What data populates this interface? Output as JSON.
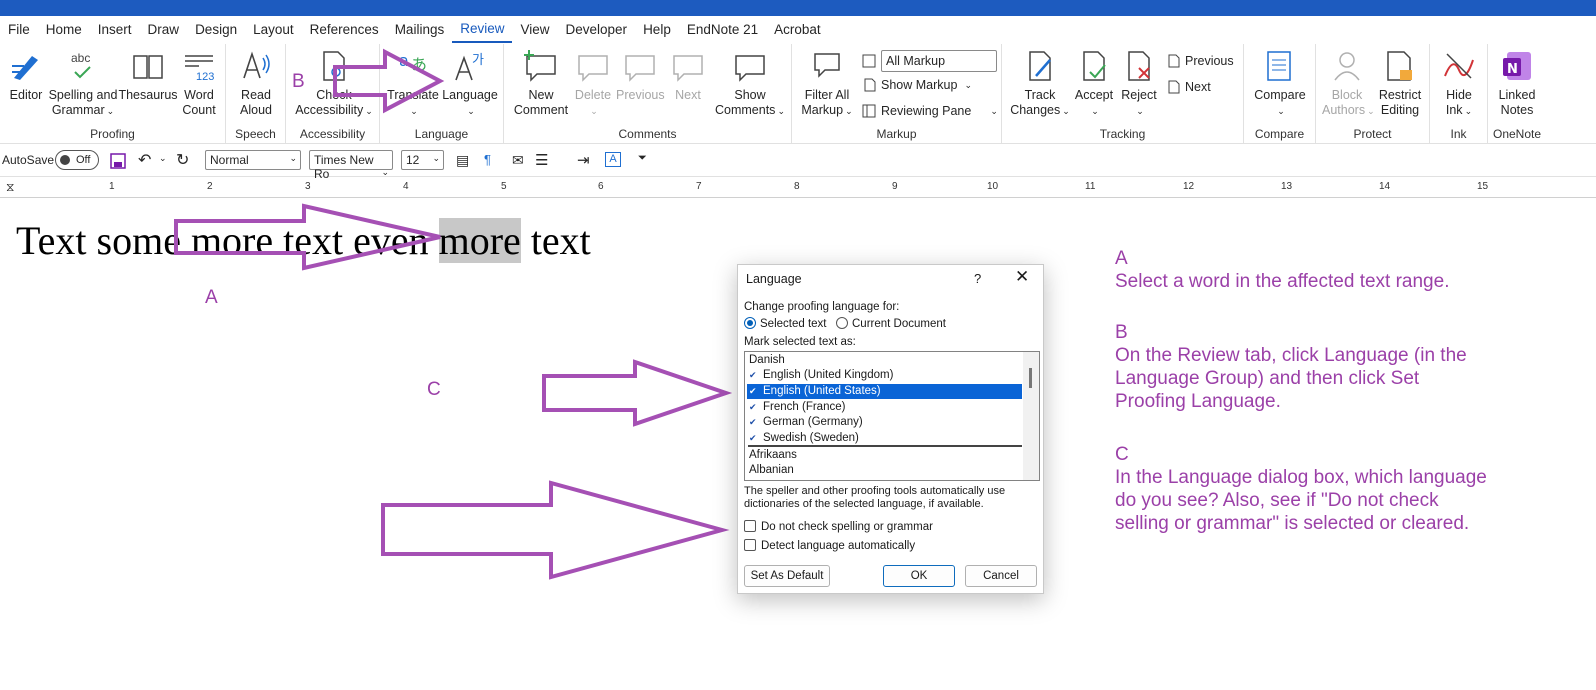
{
  "menu": [
    "File",
    "Home",
    "Insert",
    "Draw",
    "Design",
    "Layout",
    "References",
    "Mailings",
    "Review",
    "View",
    "Developer",
    "Help",
    "EndNote 21",
    "Acrobat"
  ],
  "active_menu": "Review",
  "ribbon": {
    "proofing": {
      "label": "Proofing",
      "editor": "Editor",
      "spelling_1": "Spelling and",
      "spelling_2": "Grammar",
      "thesaurus": "Thesaurus",
      "wordcount_1": "Word",
      "wordcount_2": "Count",
      "spelling_icon_text": "abc",
      "wordcount_icon_text": "123"
    },
    "speech": {
      "label": "Speech",
      "read_1": "Read",
      "read_2": "Aloud"
    },
    "accessibility": {
      "label": "Accessibility",
      "check_1": "Check",
      "check_2": "Accessibility"
    },
    "language": {
      "label": "Language",
      "translate": "Translate",
      "language": "Language"
    },
    "comments": {
      "label": "Comments",
      "new_1": "New",
      "new_2": "Comment",
      "delete": "Delete",
      "previous": "Previous",
      "next": "Next",
      "show_1": "Show",
      "show_2": "Comments"
    },
    "markup": {
      "label": "Markup",
      "filter_1": "Filter All",
      "filter_2": "Markup",
      "all_markup": "All Markup",
      "show_markup": "Show Markup",
      "reviewing_pane": "Reviewing Pane"
    },
    "tracking": {
      "label": "Tracking",
      "track_1": "Track",
      "track_2": "Changes",
      "accept": "Accept",
      "reject": "Reject",
      "previous": "Previous",
      "next": "Next"
    },
    "compare": {
      "label": "Compare",
      "compare": "Compare"
    },
    "protect": {
      "label": "Protect",
      "block_1": "Block",
      "block_2": "Authors",
      "restrict_1": "Restrict",
      "restrict_2": "Editing"
    },
    "ink": {
      "label": "Ink",
      "hide_1": "Hide",
      "hide_2": "Ink"
    },
    "onenote": {
      "label": "OneNote",
      "linked_1": "Linked",
      "linked_2": "Notes"
    }
  },
  "qat": {
    "autosave": "AutoSave",
    "autosave_state": "Off",
    "style": "Normal",
    "font": "Times New Ro",
    "size": "12"
  },
  "ruler_ticks": [
    "1",
    "2",
    "3",
    "4",
    "5",
    "6",
    "7",
    "8",
    "9",
    "10",
    "11",
    "12",
    "13",
    "14",
    "15"
  ],
  "document": {
    "text_before": "Text some more text even ",
    "text_highlight": "more",
    "text_after": " text"
  },
  "callouts": {
    "a": "A",
    "b": "B",
    "c": "C"
  },
  "notes": {
    "a_title": "A",
    "a_1": "Select a word in the affected text range.",
    "b_title": "B",
    "b_1": "On the Review tab, click Language (in the",
    "b_2": "Language Group) and then click Set",
    "b_3": "Proofing Language.",
    "c_title": "C",
    "c_1": "In the Language dialog box, which language",
    "c_2": "do you see? Also, see if \"Do not check",
    "c_3": "selling or grammar\" is selected or cleared."
  },
  "dialog": {
    "title": "Language",
    "help": "?",
    "close": "✕",
    "change_for": "Change proofing language for:",
    "radio_selected": "Selected text",
    "radio_document": "Current Document",
    "mark_as": "Mark selected text as:",
    "languages_top": [
      "Danish",
      "English (United Kingdom)",
      "English (United States)",
      "French (France)",
      "German (Germany)",
      "Swedish (Sweden)"
    ],
    "languages_bottom": [
      "Afrikaans",
      "Albanian"
    ],
    "selected_language": "English (United States)",
    "info_1": "The speller and other proofing tools automatically use",
    "info_2": "dictionaries of the selected language, if available.",
    "do_not_check": "Do not check spelling or grammar",
    "detect": "Detect language automatically",
    "set_default": "Set As Default",
    "ok": "OK",
    "cancel": "Cancel"
  },
  "colors": {
    "accent": "#185abd",
    "annotation": "#9b40a8",
    "selection": "#0a64d6"
  }
}
